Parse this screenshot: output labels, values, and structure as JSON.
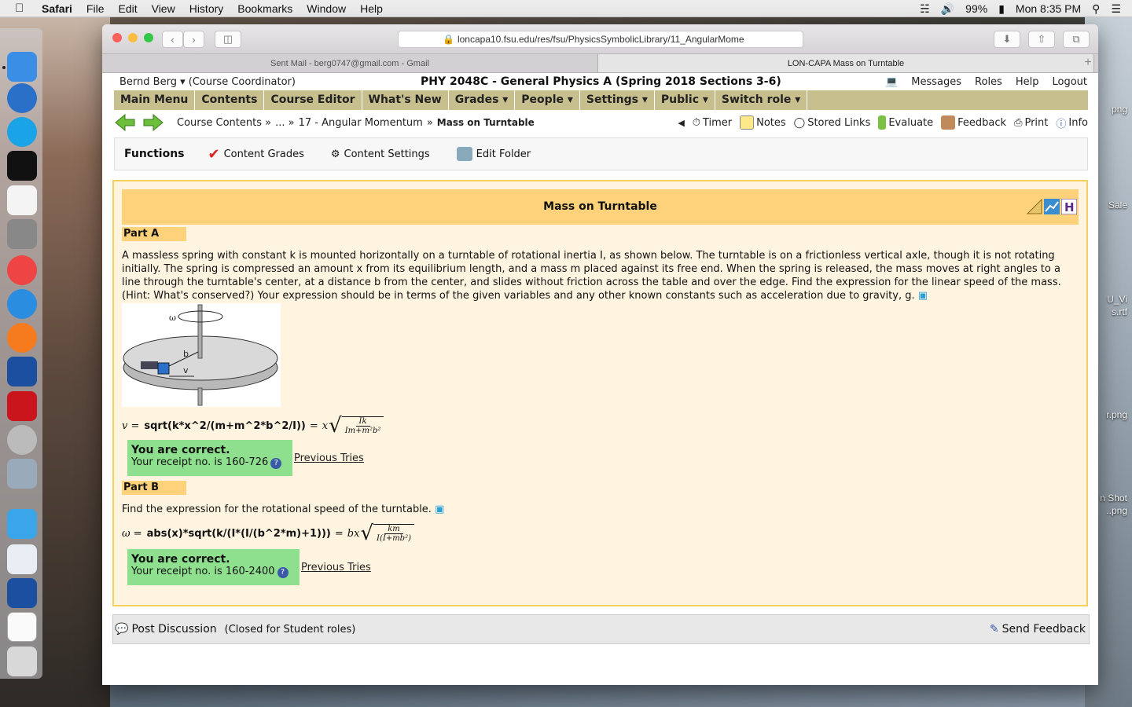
{
  "menubar": {
    "apple": "",
    "items": [
      "Safari",
      "File",
      "Edit",
      "View",
      "History",
      "Bookmarks",
      "Window",
      "Help"
    ],
    "battery": "99%",
    "clock": "Mon 8:35 PM"
  },
  "desktop": {
    "files": [
      "png",
      "Sale",
      "U_Vi",
      "s.rtf",
      "r.png",
      "n Shot",
      "..png"
    ]
  },
  "browser": {
    "url": "loncapa10.fsu.edu/res/fsu/PhysicsSymbolicLibrary/11_AngularMome",
    "tabs": [
      {
        "label": "Sent Mail - berg0747@gmail.com - Gmail"
      },
      {
        "label": "LON-CAPA Mass on Turntable"
      }
    ],
    "tab_plus": "+"
  },
  "header": {
    "user": "Bernd Berg ▾",
    "role": "(Course Coordinator)",
    "course_title": "PHY 2048C - General Physics A (Spring 2018 Sections 3-6)",
    "links": [
      "Messages",
      "Roles",
      "Help",
      "Logout"
    ]
  },
  "main_menu": [
    "Main Menu",
    "Contents",
    "Course Editor",
    "What's New",
    "Grades ▾",
    "People ▾",
    "Settings ▾",
    "Public ▾",
    "Switch role ▾"
  ],
  "breadcrumb": {
    "root": "Course Contents »",
    "ellipsis": "... »",
    "folder": "17 - Angular Momentum",
    "sep": "»",
    "current": "Mass on Turntable"
  },
  "nav_tools": [
    "Timer",
    "Notes",
    "Stored Links",
    "Evaluate",
    "Feedback",
    "Print",
    "Info"
  ],
  "functions": {
    "title": "Functions",
    "items": [
      "Content Grades",
      "Content Settings",
      "Edit Folder"
    ]
  },
  "problem": {
    "title": "Mass on Turntable",
    "partA": {
      "label": "Part A",
      "text": "A massless spring with constant k is mounted horizontally on a turntable of rotational inertia I, as shown below. The turntable is on a frictionless vertical axle, though it is not rotating initially. The spring is compressed an amount x from its equilibrium length, and a mass m placed against its free end. When the spring is released, the mass moves at right angles to a line through the turntable's center, at a distance b from the center, and slides without friction across the table and over the edge. Find the expression for the linear speed of the mass. (Hint: What's conserved?) Your expression should be in terms of the given variables and any other known constants such as acceleration due to gravity, g.",
      "figure_labels": {
        "omega": "ω",
        "b": "b",
        "v": "v"
      },
      "answer_lhs": "v =",
      "answer_code": "sqrt(k*x^2/(m+m^2*b^2/I))",
      "answer_eq": "=",
      "answer_rendered_prefix": "x",
      "answer_frac_num": "Ik",
      "answer_frac_den": "Im+m²b²",
      "correct": "You are correct.",
      "receipt": "Your receipt no. is 160-726",
      "previous": "Previous Tries"
    },
    "partB": {
      "label": "Part B",
      "text": "Find the expression for the rotational speed of the turntable.",
      "answer_lhs": "ω =",
      "answer_code": "abs(x)*sqrt(k/(I*(I/(b^2*m)+1)))",
      "answer_eq": "=",
      "answer_rendered_prefix": "bx",
      "answer_frac_num": "km",
      "answer_frac_den": "I(I+mb²)",
      "correct": "You are correct.",
      "receipt": "Your receipt no. is 160-2400",
      "previous": "Previous Tries"
    }
  },
  "footer": {
    "post": "Post Discussion",
    "closed": "(Closed for Student roles)",
    "send_feedback": "Send Feedback"
  },
  "colors": {
    "menu_bar": "#c8bf8e",
    "title_bar": "#fdd27a",
    "problem_bg": "#fff4e0",
    "correct_bg": "#8ee08e"
  }
}
